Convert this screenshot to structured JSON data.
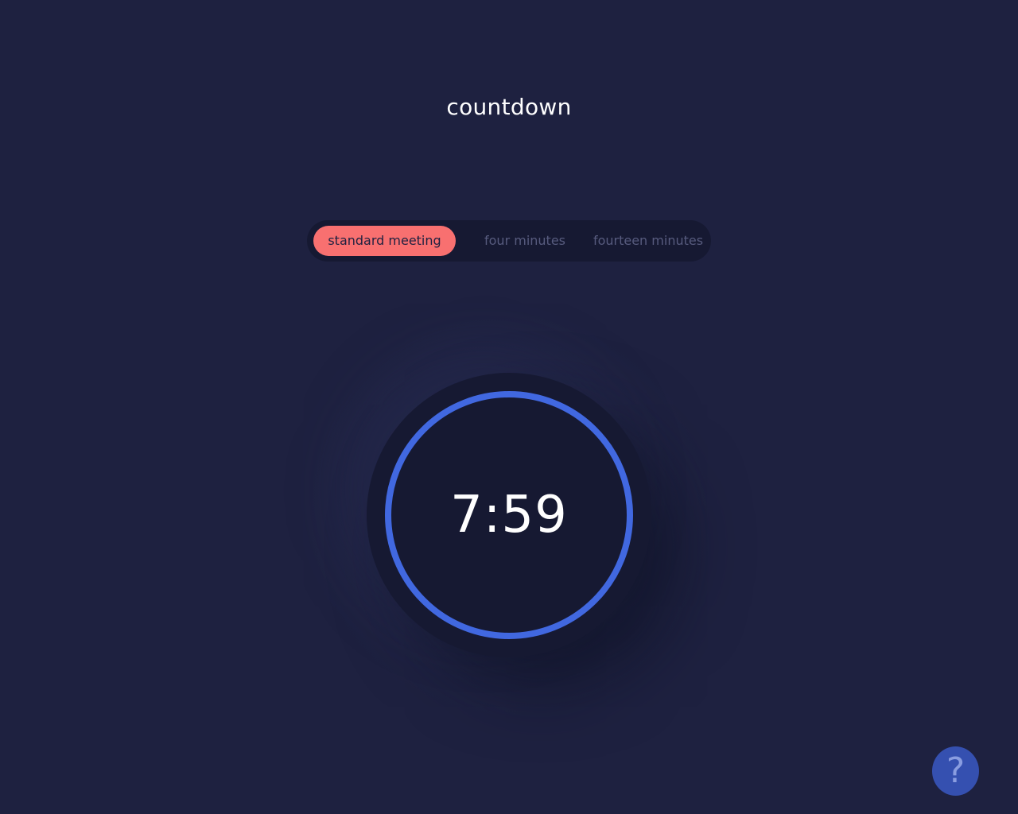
{
  "header": {
    "title": "countdown"
  },
  "modes": {
    "tabs": [
      {
        "label": "standard meeting",
        "active": true
      },
      {
        "label": "four minutes",
        "active": false
      },
      {
        "label": "fourteen minutes",
        "active": false
      }
    ]
  },
  "timer": {
    "time": "7:59",
    "progress": 1.0,
    "ring_color": "#4168e0"
  },
  "help": {
    "icon": "question-icon",
    "glyph": "?"
  },
  "colors": {
    "background": "#1e2140",
    "accent": "#f87070",
    "ring": "#4168e0"
  }
}
